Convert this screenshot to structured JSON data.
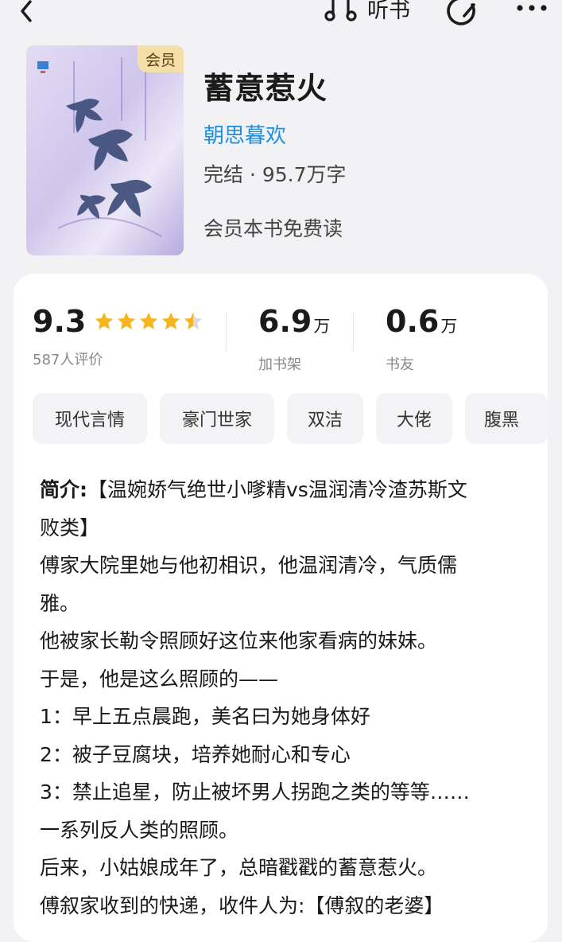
{
  "toolbar": {
    "listen_label": "听书"
  },
  "book": {
    "cover_badge": "会员",
    "title": "蓄意惹火",
    "author": "朝思暮欢",
    "status": "完结 · 95.7万字",
    "vip_note": "会员本书免费读"
  },
  "stats": {
    "rating": "9.3",
    "rating_count": "587人评价",
    "rating_stars": 4.5,
    "shelf_num": "6.9",
    "shelf_unit": "万",
    "shelf_label": "加书架",
    "friends_num": "0.6",
    "friends_unit": "万",
    "friends_label": "书友"
  },
  "tags": [
    "现代言情",
    "豪门世家",
    "双洁",
    "大佬",
    "腹黑"
  ],
  "intro": {
    "label": "简介:",
    "lines": [
      "【温婉娇气绝世小嗲精vs温润清冷渣苏斯文",
      "败类】",
      "傅家大院里她与他初相识，他温润清冷，气质儒",
      "雅。",
      "他被家长勒令照顾好这位来他家看病的妹妹。",
      "于是，他是这么照顾的——",
      "1：早上五点晨跑，美名曰为她身体好",
      "2：被子豆腐块，培养她耐心和专心",
      "3：禁止追星，防止被坏男人拐跑之类的等等……",
      "一系列反人类的照顾。",
      "后来，小姑娘成年了，总暗戳戳的蓄意惹火。",
      "傅叙家收到的快递，收件人为:【傅叙的老婆】"
    ]
  },
  "colors": {
    "accent_author": "#1e8fe0",
    "star": "#f5b51e",
    "badge_bg": "#f4dfa9"
  }
}
